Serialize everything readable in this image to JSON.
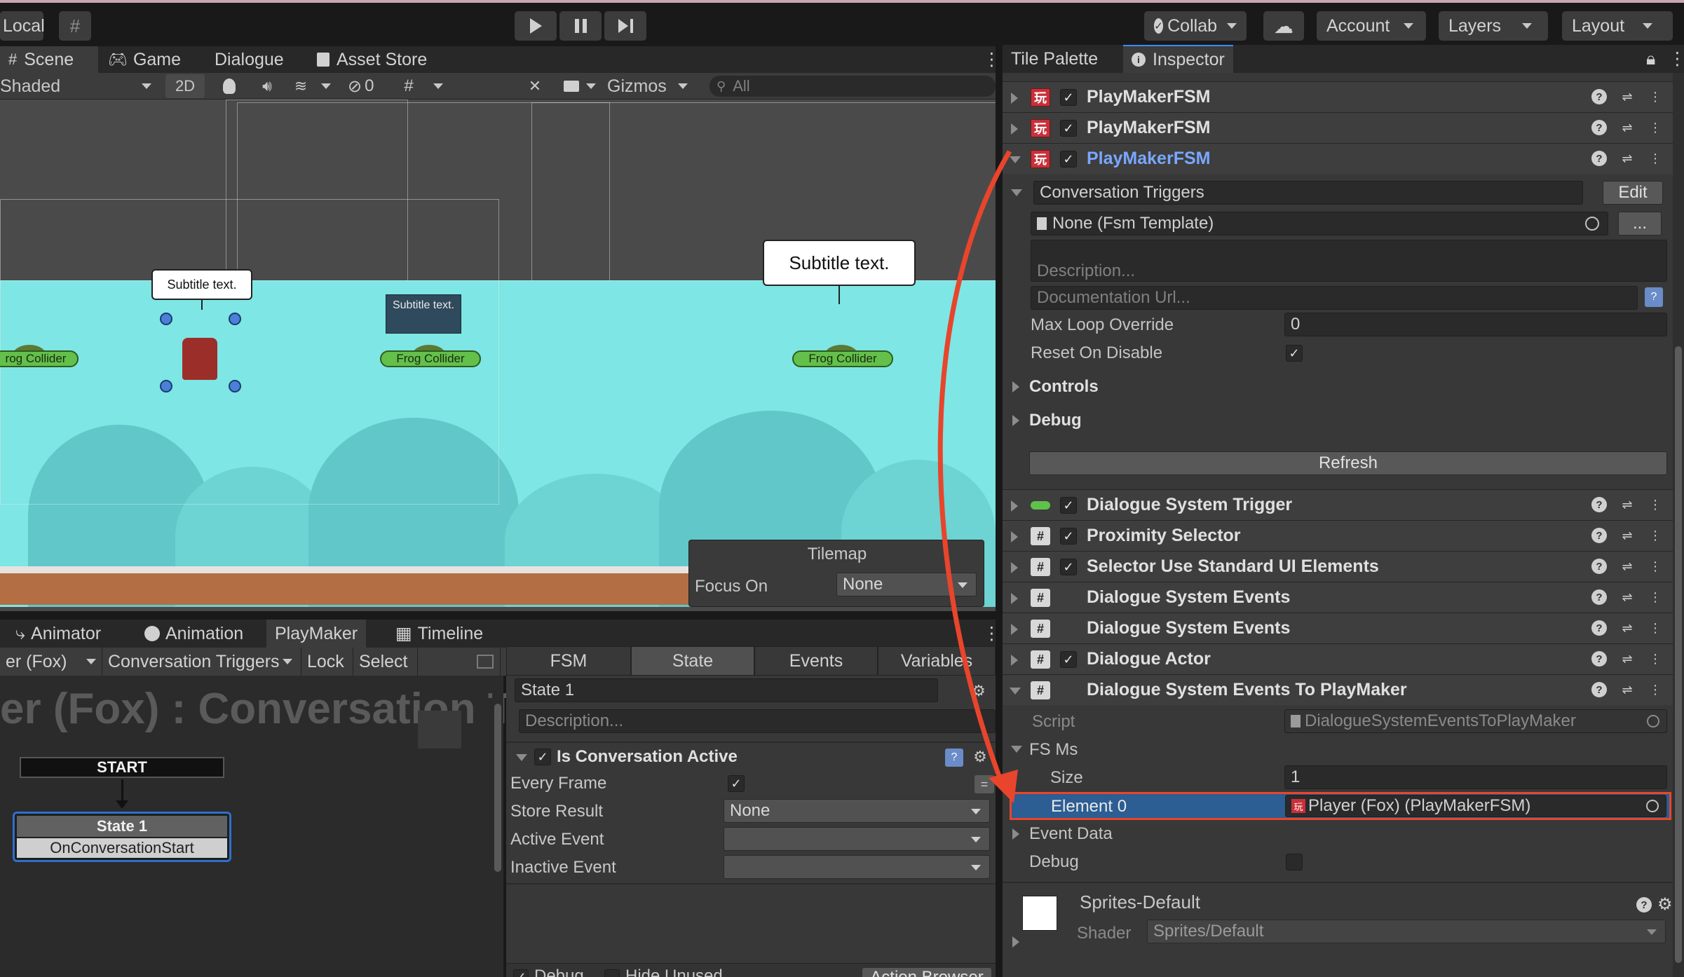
{
  "toolbar": {
    "local_label": "Local",
    "collab_label": "Collab",
    "account_label": "Account",
    "layers_label": "Layers",
    "layout_label": "Layout"
  },
  "scene_tabs": [
    "Scene",
    "Game",
    "Dialogue",
    "Asset Store"
  ],
  "scene_toolbar": {
    "shading": "Shaded",
    "mode_2d": "2D",
    "hidden_count": "0",
    "gizmos_label": "Gizmos",
    "search_placeholder": "All"
  },
  "scene": {
    "bubble_left": "Subtitle text.",
    "bubble_mid": "Subtitle text.",
    "bubble_right": "Subtitle text.",
    "frog_label_1": "rog Collider",
    "frog_label_2": "Frog Collider",
    "frog_label_3": "Frog Collider",
    "tilemap_title": "Tilemap",
    "focus_label": "Focus On",
    "focus_value": "None"
  },
  "bottom_tabs": [
    "Animator",
    "Animation",
    "PlayMaker",
    "Timeline"
  ],
  "playmaker_bar": {
    "fsm_owner": "er (Fox)",
    "fsm_name": "Conversation Triggers",
    "lock_label": "Lock",
    "select_label": "Select"
  },
  "graph": {
    "title": "er (Fox) : Conversation T",
    "start_label": "START",
    "state_name": "State 1",
    "state_event": "OnConversationStart"
  },
  "state_tabs": [
    "FSM",
    "State",
    "Events",
    "Variables"
  ],
  "state_panel": {
    "state_name": "State 1",
    "description_placeholder": "Description...",
    "action_title": "Is Conversation Active",
    "every_frame_label": "Every Frame",
    "store_result_label": "Store Result",
    "store_result_value": "None",
    "active_event_label": "Active Event",
    "inactive_event_label": "Inactive Event",
    "debug_label": "Debug",
    "hide_unused_label": "Hide Unused",
    "action_browser_label": "Action Browser"
  },
  "inspector_tabs": [
    "Tile Palette",
    "Inspector"
  ],
  "inspector": {
    "components_top": [
      "PlayMakerFSM",
      "PlayMakerFSM",
      "PlayMakerFSM"
    ],
    "fsm_name": "Conversation Triggers",
    "edit_label": "Edit",
    "template_value": "None (Fsm Template)",
    "template_more": "...",
    "description_placeholder": "Description...",
    "doc_url_placeholder": "Documentation Url...",
    "max_loop_label": "Max Loop Override",
    "max_loop_value": "0",
    "reset_label": "Reset On Disable",
    "controls_label": "Controls",
    "debug_label": "Debug",
    "refresh_label": "Refresh",
    "components": [
      "Dialogue System Trigger",
      "Proximity Selector",
      "Selector Use Standard UI Elements",
      "Dialogue System Events",
      "Dialogue System Events",
      "Dialogue Actor",
      "Dialogue System Events To PlayMaker"
    ],
    "script_label": "Script",
    "script_value": "DialogueSystemEventsToPlayMaker",
    "fsms_label": "FS Ms",
    "size_label": "Size",
    "size_value": "1",
    "element_label": "Element 0",
    "element_value": "Player (Fox) (PlayMakerFSM)",
    "event_data_label": "Event Data",
    "debug2_label": "Debug",
    "material_name": "Sprites-Default",
    "shader_label": "Shader",
    "shader_value": "Sprites/Default"
  },
  "colors": {
    "highlight_red": "#e8452c",
    "selected_blue": "#7aa7ff",
    "sky": "#7ee6e4"
  }
}
